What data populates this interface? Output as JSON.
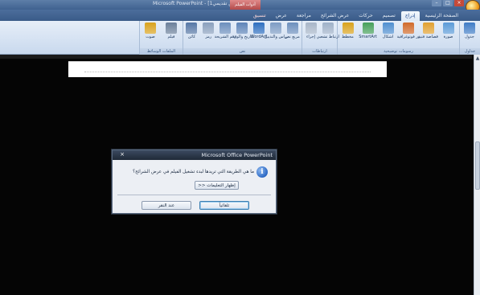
{
  "window": {
    "title": "Microsoft PowerPoint - [عرض تقديمي1]",
    "contextual_tab_group": "أدوات الفيلم",
    "minimize": "–",
    "maximize": "□",
    "close": "×"
  },
  "ribbon": {
    "tabs": [
      {
        "label": "الصفحة الرئيسية",
        "active": false
      },
      {
        "label": "إدراج",
        "active": true
      },
      {
        "label": "تصميم",
        "active": false
      },
      {
        "label": "حركات",
        "active": false
      },
      {
        "label": "عرض الشرائح",
        "active": false
      },
      {
        "label": "مراجعة",
        "active": false
      },
      {
        "label": "عرض",
        "active": false
      },
      {
        "label": "تنسيق",
        "active": false,
        "contextual": true
      }
    ],
    "groups": [
      {
        "label": "جداول",
        "buttons": [
          {
            "label": "جدول",
            "icon": "table-icon"
          }
        ]
      },
      {
        "label": "رسومات توضيحية",
        "buttons": [
          {
            "label": "صورة",
            "icon": "picture-icon"
          },
          {
            "label": "قصاصة فنية",
            "icon": "clipart-icon"
          },
          {
            "label": "ألبوم صور فوتوغرافية",
            "icon": "photo-album-icon"
          },
          {
            "label": "أشكال",
            "icon": "shapes-icon"
          },
          {
            "label": "SmartArt",
            "icon": "smartart-icon"
          },
          {
            "label": "مخطط",
            "icon": "chart-icon"
          }
        ]
      },
      {
        "label": "ارتباطات",
        "buttons": [
          {
            "label": "ارتباط تشعبي",
            "icon": "hyperlink-icon"
          },
          {
            "label": "إجراء",
            "icon": "action-icon"
          }
        ]
      },
      {
        "label": "نص",
        "buttons": [
          {
            "label": "مربع نص",
            "icon": "textbox-icon"
          },
          {
            "label": "الرأس والتذييل",
            "icon": "header-footer-icon"
          },
          {
            "label": "WordArt",
            "icon": "wordart-icon"
          },
          {
            "label": "التاريخ والوقت",
            "icon": "date-time-icon"
          },
          {
            "label": "رقم الشريحة",
            "icon": "slide-number-icon"
          },
          {
            "label": "رمز",
            "icon": "symbol-icon"
          },
          {
            "label": "كائن",
            "icon": "object-icon"
          }
        ]
      },
      {
        "label": "الملفات الوسائط",
        "buttons": [
          {
            "label": "فيلم",
            "icon": "movie-icon"
          },
          {
            "label": "صوت",
            "icon": "sound-icon"
          }
        ]
      }
    ]
  },
  "dialog": {
    "title": "Microsoft Office PowerPoint",
    "message": "ما هي الطريقة التي تريدها لبدء تشغيل الفيلم في عرض الشرائح؟",
    "details_button": "إظهار التعليمات <<",
    "auto_button": "تلقائياً",
    "click_button": "عند النقر",
    "close": "×",
    "icon": "i"
  },
  "colors": {
    "ribbon_bg": "#dde8f5",
    "title_bar": "#3f6190",
    "dialog_title": "#1f2937",
    "workspace": "#050505"
  }
}
